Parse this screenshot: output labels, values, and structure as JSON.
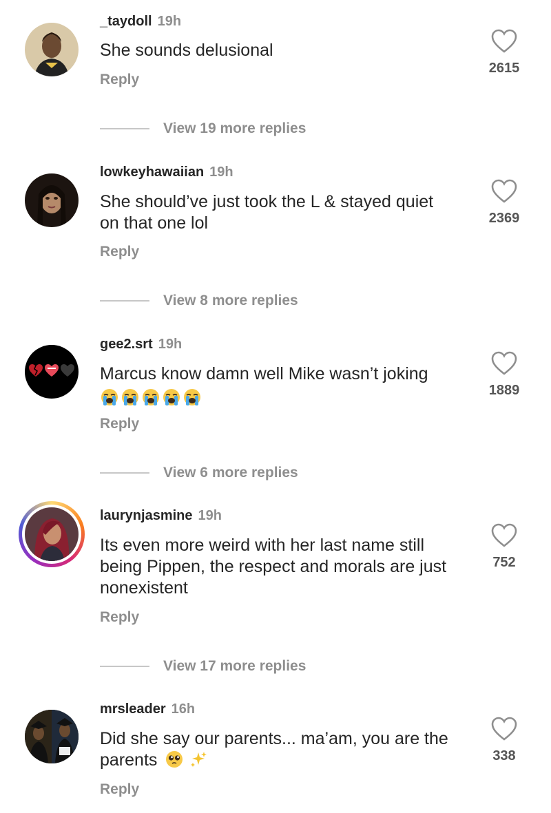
{
  "comments": [
    {
      "username": "_taydoll",
      "time": "19h",
      "text_lines": [
        "She sounds delusional"
      ],
      "reply_label": "Reply",
      "likes": "2615",
      "view_replies": "View 19 more replies",
      "avatar": "woman-portrait-avatar"
    },
    {
      "username": "lowkeyhawaiian",
      "time": "19h",
      "text_lines": [
        "She should’ve just took the L & stayed quiet",
        "on that one lol"
      ],
      "reply_label": "Reply",
      "likes": "2369",
      "view_replies": "View 8 more replies",
      "avatar": "woman-portrait-avatar"
    },
    {
      "username": "gee2.srt",
      "time": "19h",
      "text_lines": [
        "Marcus know damn well Mike wasn’t joking"
      ],
      "emoji_count": 5,
      "emoji": "crying-face",
      "reply_label": "Reply",
      "likes": "1889",
      "view_replies": "View 6 more replies",
      "avatar": "hearts-avatar"
    },
    {
      "username": "laurynjasmine",
      "time": "19h",
      "text_lines": [
        "Its even more weird with her last name still",
        "being Pippen, the respect and morals are just",
        "nonexistent"
      ],
      "reply_label": "Reply",
      "likes": "752",
      "view_replies": "View 17 more replies",
      "avatar": "story-ring-avatar"
    },
    {
      "username": "mrsleader",
      "time": "16h",
      "text_lines": [
        "Did she say our parents... ma’am, you are the",
        "parents"
      ],
      "trailing_emoji": [
        "pleading-face",
        "sparkles"
      ],
      "reply_label": "Reply",
      "likes": "338",
      "avatar": "graduation-avatar"
    }
  ],
  "colors": {
    "text": "#262626",
    "secondary": "#8e8e8e",
    "divider": "#c7c7c7",
    "background": "#ffffff"
  }
}
